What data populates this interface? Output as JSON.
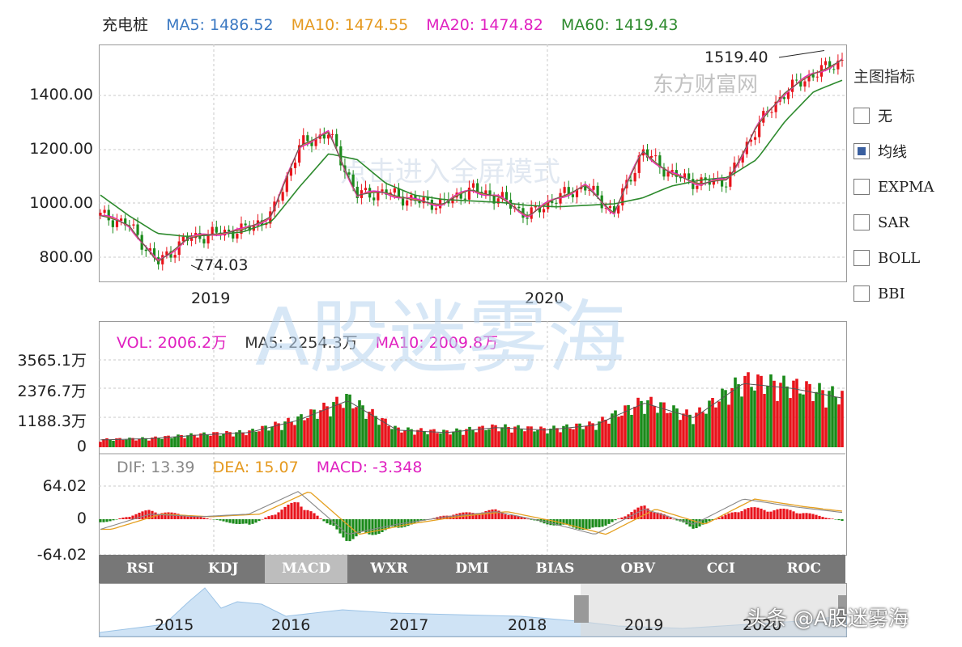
{
  "main_legend": {
    "name": "充电桩",
    "ma5": "MA5: 1486.52",
    "ma10": "MA10: 1474.55",
    "ma20": "MA20: 1474.82",
    "ma60": "MA60: 1419.43"
  },
  "main_yticks": [
    "1400.00",
    "1200.00",
    "1000.00",
    "800.00"
  ],
  "main_xticks": [
    "2019",
    "2020"
  ],
  "annotations": {
    "high": "1519.40",
    "low": "774.03"
  },
  "sidebar": {
    "title": "主图指标",
    "options": [
      {
        "label": "无",
        "checked": false
      },
      {
        "label": "均线",
        "checked": true
      },
      {
        "label": "EXPMA",
        "checked": false
      },
      {
        "label": "SAR",
        "checked": false
      },
      {
        "label": "BOLL",
        "checked": false
      },
      {
        "label": "BBI",
        "checked": false
      }
    ]
  },
  "vol_legend": {
    "vol": "VOL: 2006.2万",
    "ma5": "MA5: 2254.3万",
    "ma10": "MA10: 2009.8万"
  },
  "vol_yticks": [
    "3565.1万",
    "2376.7万",
    "1188.3万",
    "0"
  ],
  "macd_legend": {
    "dif": "DIF: 13.39",
    "dea": "DEA: 15.07",
    "macd": "MACD: -3.348"
  },
  "macd_yticks": [
    "64.02",
    "0",
    "-64.02"
  ],
  "tabs": [
    {
      "label": "RSI",
      "active": false
    },
    {
      "label": "KDJ",
      "active": false
    },
    {
      "label": "MACD",
      "active": true
    },
    {
      "label": "WXR",
      "active": false
    },
    {
      "label": "DMI",
      "active": false
    },
    {
      "label": "BIAS",
      "active": false
    },
    {
      "label": "OBV",
      "active": false
    },
    {
      "label": "CCI",
      "active": false
    },
    {
      "label": "ROC",
      "active": false
    }
  ],
  "overview_years": [
    "2015",
    "2016",
    "2017",
    "2018",
    "2019",
    "2020"
  ],
  "watermarks": {
    "big": "A股迷雾海",
    "mid": "点击进入全屏模式",
    "logo": "东方财富网"
  },
  "signature": "头条 @A股迷雾海",
  "colors": {
    "up": "#e8131b",
    "down": "#1a8a1a",
    "ma5": "#555555",
    "ma10": "#e5a020",
    "ma20": "#e020c0",
    "ma60": "#2d8a2d",
    "dif": "#888888",
    "dea": "#e5a020",
    "macd": "#e020c0"
  },
  "chart_data": [
    {
      "type": "line",
      "title": "充电桩",
      "ylim": [
        740,
        1540
      ],
      "x": [
        "2018-08",
        "2018-09",
        "2018-10",
        "2018-11",
        "2018-12",
        "2019-01",
        "2019-02",
        "2019-03",
        "2019-04",
        "2019-05",
        "2019-06",
        "2019-07",
        "2019-08",
        "2019-09",
        "2019-10",
        "2019-11",
        "2019-12",
        "2020-01",
        "2020-02",
        "2020-03",
        "2020-04",
        "2020-05",
        "2020-06",
        "2020-07",
        "2020-08",
        "2020-09",
        "2020-10"
      ],
      "series": [
        {
          "name": "MA5",
          "values": [
            960,
            930,
            800,
            880,
            900,
            910,
            960,
            1200,
            1240,
            1030,
            1040,
            1010,
            1000,
            1050,
            1020,
            960,
            1020,
            1060,
            970,
            1180,
            1100,
            1070,
            1080,
            1260,
            1380,
            1440,
            1487
          ]
        },
        {
          "name": "MA60",
          "values": [
            1030,
            960,
            900,
            890,
            895,
            905,
            940,
            1060,
            1170,
            1150,
            1070,
            1030,
            1015,
            1010,
            1005,
            995,
            990,
            995,
            1000,
            1020,
            1060,
            1080,
            1090,
            1150,
            1280,
            1380,
            1419
          ]
        }
      ],
      "annotations": [
        {
          "label": "1519.40",
          "x": "2020-10",
          "y": 1519.4
        },
        {
          "label": "774.03",
          "x": "2018-10",
          "y": 774.03
        }
      ]
    },
    {
      "type": "bar",
      "title": "VOL",
      "ylim": [
        0,
        3565.1
      ],
      "categories": [
        "2018-08",
        "2018-10",
        "2018-12",
        "2019-02",
        "2019-03",
        "2019-04",
        "2019-06",
        "2019-08",
        "2019-10",
        "2019-12",
        "2020-02",
        "2020-03",
        "2020-05",
        "2020-07",
        "2020-08",
        "2020-10"
      ],
      "series": [
        {
          "name": "VOL",
          "values": [
            300,
            350,
            500,
            600,
            1100,
            1900,
            700,
            600,
            800,
            700,
            900,
            1800,
            1200,
            2600,
            2400,
            2006.2
          ]
        }
      ]
    },
    {
      "type": "bar",
      "title": "MACD",
      "ylim": [
        -64.02,
        64.02
      ],
      "categories": [
        "2018-08",
        "2018-10",
        "2018-12",
        "2019-02",
        "2019-03",
        "2019-04",
        "2019-06",
        "2019-08",
        "2019-10",
        "2019-12",
        "2020-02",
        "2020-03",
        "2020-05",
        "2020-07",
        "2020-08",
        "2020-10"
      ],
      "series": [
        {
          "name": "MACD",
          "values": [
            -10,
            20,
            5,
            -15,
            40,
            -45,
            -20,
            10,
            20,
            -10,
            -25,
            30,
            -20,
            25,
            20,
            -3.348
          ]
        },
        {
          "name": "DIF",
          "values": [
            -20,
            10,
            5,
            10,
            55,
            -30,
            -10,
            5,
            15,
            -5,
            -30,
            20,
            -10,
            40,
            25,
            13.39
          ]
        }
      ]
    }
  ]
}
